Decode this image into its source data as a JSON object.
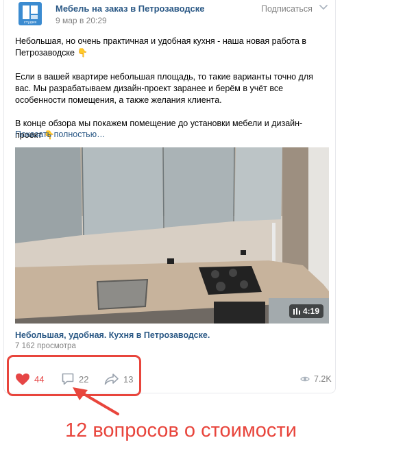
{
  "post": {
    "author": "Мебель на заказ в Петрозаводске",
    "avatar_caption": "студия",
    "date": "9 мар в 20:29",
    "subscribe_label": "Подписаться",
    "paragraphs": [
      "Небольшая, но очень практичная и удобная кухня - наша новая работа в Петрозаводске 👇",
      "Если в вашей квартире небольшая площадь, то такие варианты точно для вас. Мы разрабатываем дизайн-проект заранее и берём в учёт все особенности помещения, а также желания клиента.",
      "В конце обзора мы покажем помещение до установки мебели и дизайн-проект 👇"
    ],
    "show_more": "Показать полностью…",
    "video": {
      "duration": "4:19",
      "title": "Небольшая, удобная. Кухня в Петрозаводске.",
      "views": "7 162 просмотра"
    },
    "actions": {
      "likes": "44",
      "comments": "22",
      "shares": "13",
      "views": "7.2K"
    }
  },
  "annotation": {
    "caption": "12 вопросов о стоимости",
    "color": "#e8453c"
  },
  "colors": {
    "link": "#2a5885",
    "muted": "#828282",
    "like": "#e64646"
  },
  "icons": [
    "dropdown-chevron-icon",
    "heart-icon",
    "comment-icon",
    "share-icon",
    "eye-icon",
    "playlist-icon"
  ]
}
